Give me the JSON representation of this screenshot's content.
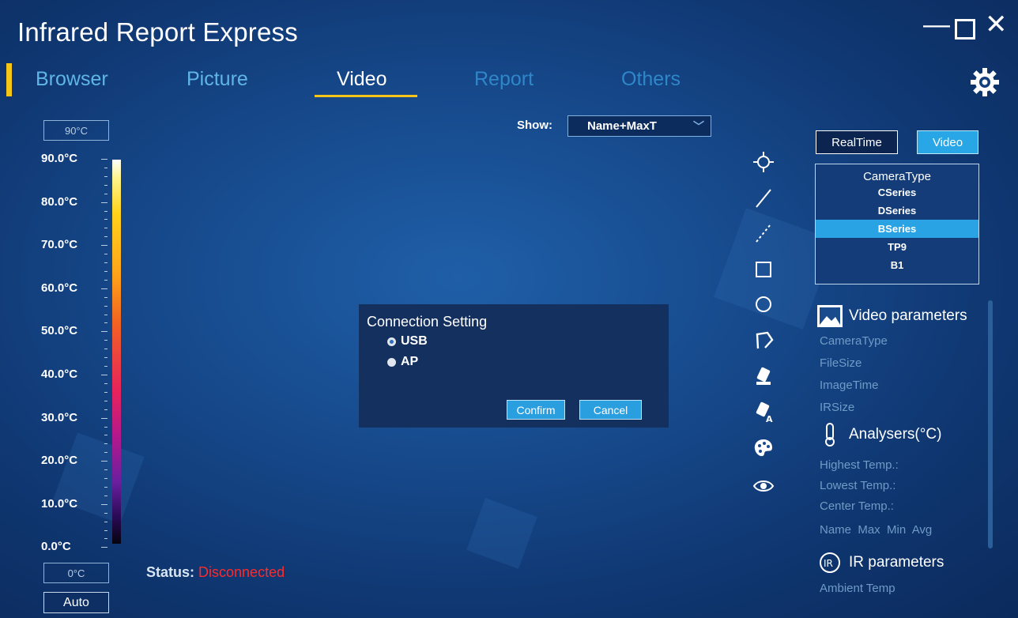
{
  "window": {
    "title": "Infrared Report Express",
    "min": "—",
    "close": "✕"
  },
  "tabs": [
    {
      "label": "Browser"
    },
    {
      "label": "Picture"
    },
    {
      "label": "Video"
    },
    {
      "label": "Report"
    },
    {
      "label": "Others"
    }
  ],
  "active_tab": "Video",
  "scale": {
    "max_box": "90°C",
    "min_box": "0°C",
    "labels": [
      "90.0°C",
      "80.0°C",
      "70.0°C",
      "60.0°C",
      "50.0°C",
      "40.0°C",
      "30.0°C",
      "20.0°C",
      "10.0°C",
      "0.0°C"
    ],
    "auto_label": "Auto"
  },
  "status": {
    "label": "Status:",
    "value": "Disconnected"
  },
  "show": {
    "label": "Show:",
    "value": "Name+MaxT"
  },
  "dialog": {
    "title": "Connection Setting",
    "options": [
      {
        "label": "USB",
        "selected": true
      },
      {
        "label": "AP",
        "selected": false
      }
    ],
    "confirm": "Confirm",
    "cancel": "Cancel"
  },
  "tools": [
    "crosshair-icon",
    "line-icon",
    "dashed-line-icon",
    "rectangle-icon",
    "circle-icon",
    "polygon-icon",
    "eraser-icon",
    "eraser-text-icon",
    "palette-icon",
    "eye-icon"
  ],
  "modes": {
    "realtime": "RealTime",
    "video": "Video"
  },
  "camera_list": {
    "header": "CameraType",
    "items": [
      "CSeries",
      "DSeries",
      "BSeries",
      "TP9",
      "B1"
    ],
    "selected": "BSeries"
  },
  "video_params": {
    "title": "Video parameters",
    "items": [
      "CameraType",
      "FileSize",
      "ImageTime",
      "IRSize"
    ]
  },
  "analysers": {
    "title": "Analysers(°C)",
    "items": [
      "Highest Temp.:",
      "Lowest Temp.:",
      "Center Temp.:"
    ],
    "columns": "Name  Max  Min  Avg"
  },
  "ir_params": {
    "title": "IR parameters",
    "items": [
      "Ambient Temp"
    ]
  },
  "colors": {
    "accent": "#f5c518",
    "highlight": "#2aa3e4",
    "status_error": "#ff2a2a"
  }
}
